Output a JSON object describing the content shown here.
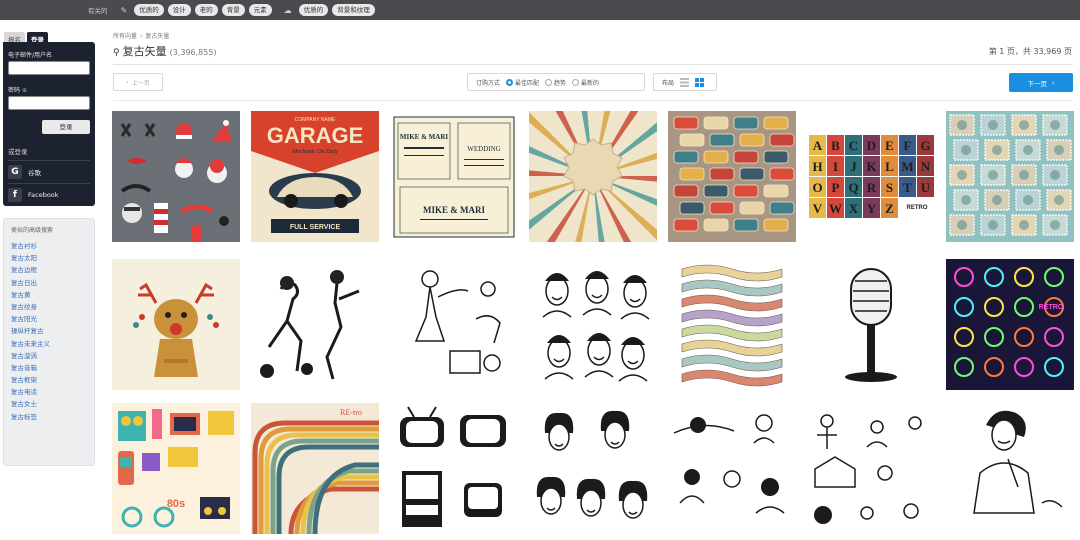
{
  "topbar": {
    "related_label": "有关的",
    "group1": [
      "优质的",
      "设计",
      "老的",
      "背景",
      "元素"
    ],
    "group2": [
      "优质的",
      "背景和纹理"
    ]
  },
  "login": {
    "tabs": [
      "报名",
      "登录"
    ],
    "email_label": "电子邮件/用户名",
    "password_label": "密码",
    "password_hint_icon": "⊕",
    "submit_label": "登录",
    "or_label": "或登录",
    "google_label": "谷歌",
    "facebook_label": "Facebook"
  },
  "similar": {
    "title": "类似的高级搜索",
    "items": [
      "复古衬衫",
      "复古太阳",
      "复古边框",
      "复古日出",
      "复古黄",
      "复古纹身",
      "复古阳光",
      "操纵杆复古",
      "复古未来主义",
      "复古漩涡",
      "复古音箱",
      "复古框架",
      "复古电话",
      "复古女士",
      "复古标签"
    ]
  },
  "breadcrumb": [
    "所有向量",
    "›",
    "复古矢量"
  ],
  "page_title": "复古矢量",
  "result_count": "(3,396,855)",
  "page_info": "第 1 页，共 33,969 页",
  "toolbar": {
    "prev_label": "上一页",
    "sort_label": "订购方式",
    "sort_options": [
      "最佳匹配",
      "趋势",
      "最新的"
    ],
    "layout_label": "布局",
    "next_label": "下一页"
  },
  "thumbnails": [
    {
      "name": "santa-props"
    },
    {
      "name": "garage-poster",
      "text": "GARAGE",
      "sub": "FULL SERVICE",
      "top": "COMPANY NAME",
      "tag": "Mechanic On Duty"
    },
    {
      "name": "wedding-invitation",
      "text": "MIKE & MARI",
      "sub": "WEDDING"
    },
    {
      "name": "sunburst-frame"
    },
    {
      "name": "retro-labels"
    },
    {
      "name": "retro-alphabet",
      "text": "RETRO"
    },
    {
      "name": "vintage-stamps"
    },
    {
      "name": "reindeer"
    },
    {
      "name": "bowling-couple"
    },
    {
      "name": "waitress-scene"
    },
    {
      "name": "retro-men-faces"
    },
    {
      "name": "ribbon-banners"
    },
    {
      "name": "microphone"
    },
    {
      "name": "neon-icons",
      "text": "RETRO"
    },
    {
      "name": "eighties-objects",
      "text": "80s"
    },
    {
      "name": "retro-stripes",
      "text": "RE-tro"
    },
    {
      "name": "retro-tvs"
    },
    {
      "name": "retro-women-faces"
    },
    {
      "name": "sleeping-women"
    },
    {
      "name": "retro-people-scenes"
    },
    {
      "name": "pinup-woman"
    }
  ]
}
